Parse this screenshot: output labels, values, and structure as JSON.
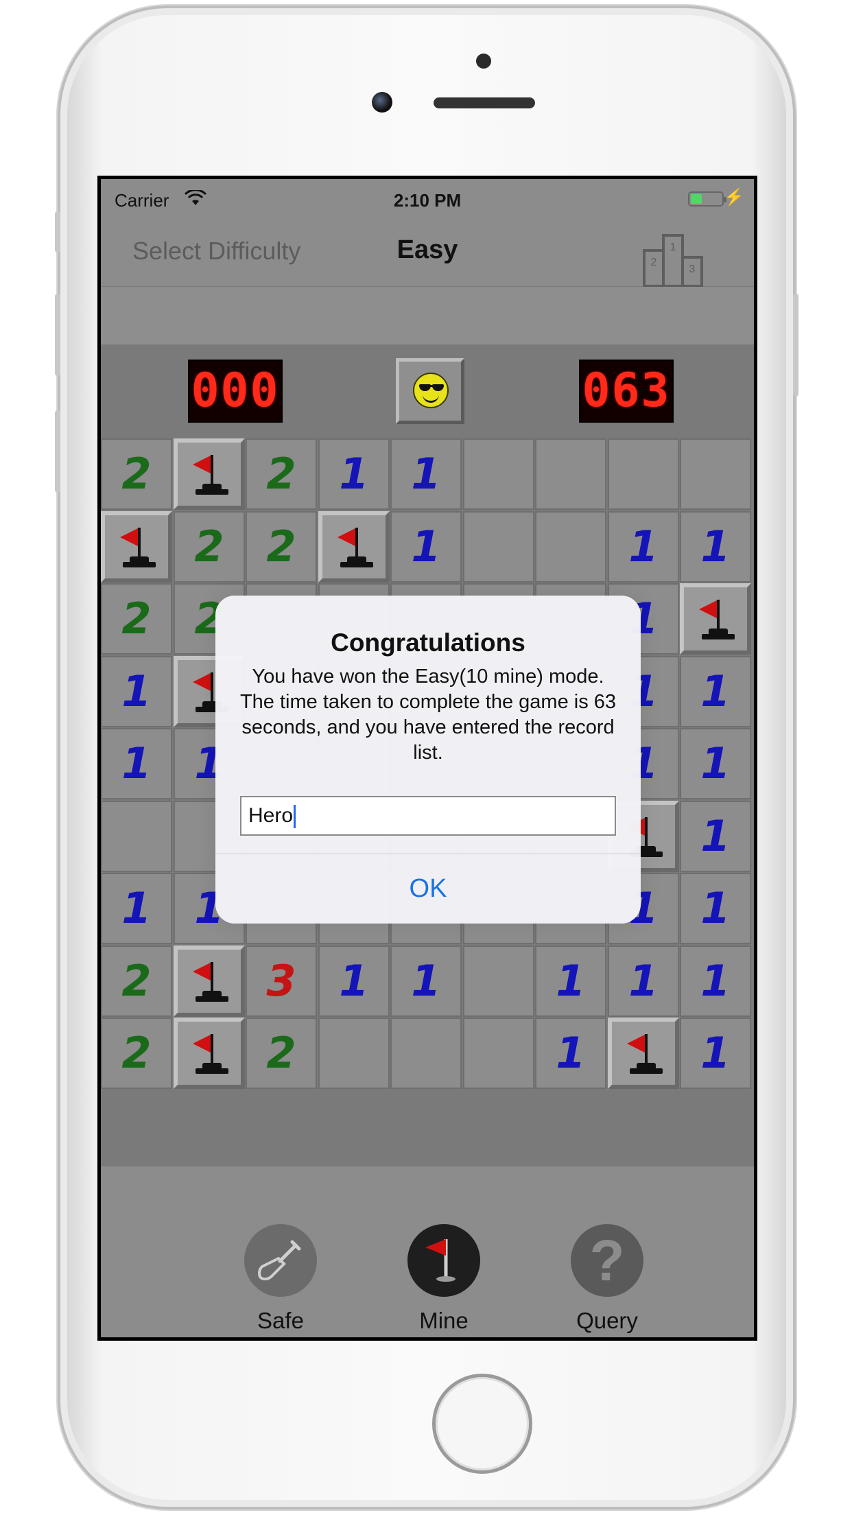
{
  "status_bar": {
    "carrier": "Carrier",
    "time": "2:10 PM"
  },
  "nav": {
    "left_label": "Select Difficulty",
    "title": "Easy",
    "leaderboard_icon": "podium-icon",
    "podium_places": [
      "2",
      "1",
      "3"
    ]
  },
  "counters": {
    "mines_left": "000",
    "timer": "063",
    "face_icon": "sunglasses-smiley-icon"
  },
  "board": {
    "rows": [
      [
        "2",
        "F",
        "2",
        "1",
        "1",
        "",
        "",
        "",
        ""
      ],
      [
        "F",
        "2",
        "2",
        "F",
        "1",
        "",
        "",
        "1",
        "1"
      ],
      [
        "2",
        "2",
        "?",
        "?",
        "?",
        "?",
        "?",
        "1",
        "F"
      ],
      [
        "1",
        "F",
        "?",
        "?",
        "?",
        "?",
        "?",
        "1",
        "1"
      ],
      [
        "1",
        "1",
        "?",
        "?",
        "?",
        "?",
        "?",
        "1",
        "1"
      ],
      [
        "",
        "",
        "?",
        "?",
        "?",
        "?",
        "?",
        "F",
        "1"
      ],
      [
        "1",
        "1",
        "?",
        "?",
        "?",
        "?",
        "?",
        "1",
        "1"
      ],
      [
        "2",
        "F",
        "3",
        "1",
        "1",
        "",
        "1",
        "1",
        "1"
      ],
      [
        "2",
        "F",
        "2",
        "",
        "",
        "",
        "1",
        "F",
        "1"
      ]
    ],
    "colors": {
      "1": "#1414b8",
      "2": "#1a6a1a",
      "3": "#c41414"
    }
  },
  "toolbar": {
    "safe": {
      "label": "Safe",
      "icon": "shovel-icon"
    },
    "mine": {
      "label": "Mine",
      "icon": "flag-icon"
    },
    "query": {
      "label": "Query",
      "icon": "question-icon",
      "glyph": "?"
    }
  },
  "dialog": {
    "title": "Congratulations",
    "message": "You have won the Easy(10 mine) mode. The time taken to complete the game is 63 seconds, and you have entered the record list.",
    "input_value": "Hero",
    "ok_label": "OK"
  }
}
